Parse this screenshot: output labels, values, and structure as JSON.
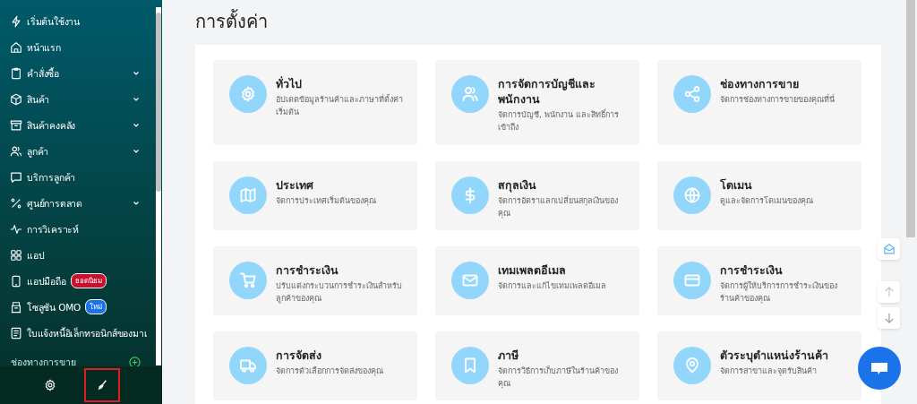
{
  "sidebar": {
    "items": [
      {
        "label": "เริ่มต้นใช้งาน",
        "expandable": false
      },
      {
        "label": "หน้าแรก",
        "expandable": false
      },
      {
        "label": "คำสั่งซื้อ",
        "expandable": true
      },
      {
        "label": "สินค้า",
        "expandable": true
      },
      {
        "label": "สินค้าคงคลัง",
        "expandable": true
      },
      {
        "label": "ลูกค้า",
        "expandable": true
      },
      {
        "label": "บริการลูกค้า",
        "expandable": false
      },
      {
        "label": "ศูนย์การตลาด",
        "expandable": true
      },
      {
        "label": "การวิเคราะห์",
        "expandable": false
      },
      {
        "label": "แอป",
        "expandable": false
      },
      {
        "label": "แอปมือถือ",
        "expandable": false,
        "badge": {
          "text": "ยอดนิยม",
          "color": "#c8102e"
        }
      },
      {
        "label": "โซลูชัน OMO",
        "expandable": false,
        "badge": {
          "text": "ใหม่",
          "color": "#1a73e8"
        }
      },
      {
        "label": "ใบแจ้งหนี้อิเล็กทรอนิกส์ของมาเ",
        "expandable": false
      }
    ],
    "section": "ช่องทางการขาย",
    "footer": [
      {
        "kind": "settings",
        "highlighted": false
      },
      {
        "kind": "brush",
        "highlighted": true
      }
    ]
  },
  "title": "การตั้งค่า",
  "cards": [
    {
      "title": "ทั่วไป",
      "description": "อัปเดตข้อมูลร้านค้าและภาษาที่ตั้งค่าเริ่มต้น"
    },
    {
      "title": "การจัดการบัญชีและพนักงาน",
      "description": "จัดการบัญชี, พนักงาน และสิทธิ์การเข้าถึง"
    },
    {
      "title": "ช่องทางการขาย",
      "description": "จัดการช่องทางการขายของคุณที่นี่"
    },
    {
      "title": "ประเทศ",
      "description": "จัดการประเทศเริ่มต้นของคุณ"
    },
    {
      "title": "สกุลเงิน",
      "description": "จัดการอัตราแลกเปลี่ยนสกุลเงินของคุณ"
    },
    {
      "title": "โดเมน",
      "description": "ดูและจัดการโดเมนของคุณ"
    },
    {
      "title": "การชำระเงิน",
      "description": "ปรับแต่งกระบวนการชำระเงินสำหรับลูกค้าของคุณ"
    },
    {
      "title": "เทมเพลตอีเมล",
      "description": "จัดการและแก้ไขเทมเพลตอีเมล"
    },
    {
      "title": "การชำระเงิน",
      "description": "จัดการผู้ให้บริการการชำระเงินของร้านค้าของคุณ"
    },
    {
      "title": "การจัดส่ง",
      "description": "จัดการตัวเลือกการจัดส่งของคุณ"
    },
    {
      "title": "ภาษี",
      "description": "จัดการวิธีการเก็บภาษีในร้านค้าของคุณ"
    },
    {
      "title": "ตัวระบุตำแหน่งร้านค้า",
      "description": "จัดการสาขาและจุดรับสินค้า"
    }
  ]
}
